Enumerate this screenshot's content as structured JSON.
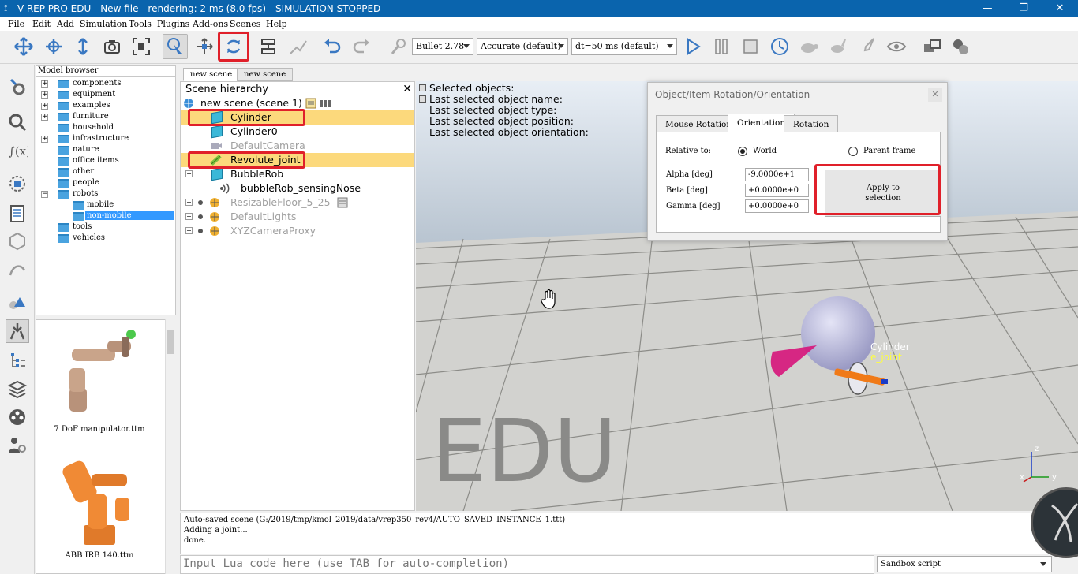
{
  "window": {
    "title": "V-REP PRO EDU - New file - rendering: 2 ms (8.0 fps) - SIMULATION STOPPED",
    "minimize": "—",
    "maximize": "❐",
    "close": "✕"
  },
  "menu": [
    "File",
    "Edit",
    "Add",
    "Simulation",
    "Tools",
    "Plugins",
    "Add-ons",
    "Scenes",
    "Help"
  ],
  "toolbar": {
    "engine": "Bullet 2.78",
    "accuracy": "Accurate (default)",
    "timestep": "dt=50 ms (default)"
  },
  "model_browser": {
    "header": "Model browser",
    "items": [
      {
        "label": "components",
        "exp": "+"
      },
      {
        "label": "equipment",
        "exp": "+"
      },
      {
        "label": "examples",
        "exp": "+"
      },
      {
        "label": "furniture",
        "exp": "+"
      },
      {
        "label": "household",
        "exp": ""
      },
      {
        "label": "infrastructure",
        "exp": "+"
      },
      {
        "label": "nature",
        "exp": ""
      },
      {
        "label": "office items",
        "exp": ""
      },
      {
        "label": "other",
        "exp": ""
      },
      {
        "label": "people",
        "exp": ""
      },
      {
        "label": "robots",
        "exp": "−"
      },
      {
        "label": "mobile",
        "exp": ""
      },
      {
        "label": "non-mobile",
        "exp": ""
      },
      {
        "label": "tools",
        "exp": ""
      },
      {
        "label": "vehicles",
        "exp": ""
      }
    ],
    "thumbnails": [
      "7 DoF manipulator.ttm",
      "ABB IRB 140.ttm"
    ]
  },
  "scene_tabs": [
    "new scene",
    "new scene"
  ],
  "scene_hierarchy": {
    "title": "Scene hierarchy",
    "close": "✕",
    "rows": [
      {
        "label": "new scene (scene 1)"
      },
      {
        "label": "Cylinder"
      },
      {
        "label": "Cylinder0"
      },
      {
        "label": "DefaultCamera"
      },
      {
        "label": "Revolute_joint"
      },
      {
        "label": "BubbleRob"
      },
      {
        "label": "bubbleRob_sensingNose"
      },
      {
        "label": "ResizableFloor_5_25"
      },
      {
        "label": "DefaultLights"
      },
      {
        "label": "XYZCameraProxy"
      }
    ]
  },
  "viewport": {
    "info": [
      "Selected objects:",
      "Last selected object name:",
      "Last selected object type:",
      "Last selected object position:",
      "Last selected object orientation:"
    ],
    "watermark": "EDU",
    "label_cylinder": "Cylinder",
    "label_joint": "e_joint",
    "axis_z": "z",
    "axis_x": "x",
    "axis_y": "y"
  },
  "dialog": {
    "title": "Object/Item Rotation/Orientation",
    "close": "✕",
    "tabs": [
      "Mouse Rotation",
      "Orientation",
      "Rotation"
    ],
    "relative_to": "Relative to:",
    "world": "World",
    "parent_frame": "Parent frame",
    "fields": [
      {
        "label": "Alpha [deg]",
        "value": "-9.0000e+1"
      },
      {
        "label": "Beta [deg]",
        "value": "+0.0000e+0"
      },
      {
        "label": "Gamma [deg]",
        "value": "+0.0000e+0"
      }
    ],
    "apply_line1": "Apply to",
    "apply_line2": "selection"
  },
  "console": {
    "lines": [
      "Auto-saved scene (G:/2019/tmp/kmol_2019/data/vrep350_rev4/AUTO_SAVED_INSTANCE_1.ttt)",
      "Adding a joint...",
      "done."
    ]
  },
  "lua_input": {
    "placeholder": "Input Lua code here (use TAB for auto-completion)"
  },
  "script_select": "Sandbox script"
}
